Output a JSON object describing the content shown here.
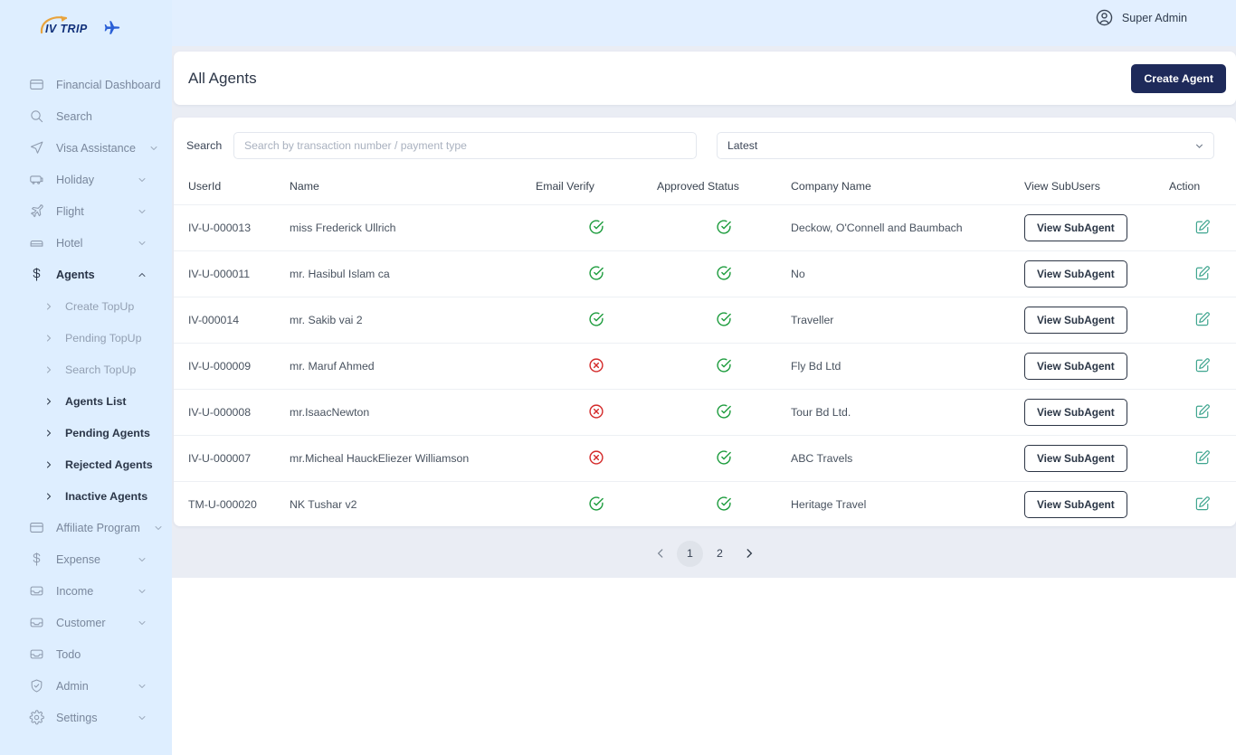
{
  "brand": {
    "logo_text": "IV TRIP",
    "arc_color": "#e8a33d",
    "plane_color": "#2a5fd6",
    "text_color": "#11307a"
  },
  "topbar": {
    "user_name": "Super Admin",
    "avatar_icon": "user-circle-icon"
  },
  "sidebar": {
    "items": [
      {
        "label": "Financial Dashboard",
        "icon": "card-icon",
        "chevron": false,
        "active": false
      },
      {
        "label": "Search",
        "icon": "search-icon",
        "chevron": false,
        "active": false
      },
      {
        "label": "Visa Assistance",
        "icon": "send-icon",
        "chevron": true,
        "active": false
      },
      {
        "label": "Holiday",
        "icon": "bus-icon",
        "chevron": true,
        "active": false
      },
      {
        "label": "Flight",
        "icon": "plane-icon",
        "chevron": true,
        "active": false
      },
      {
        "label": "Hotel",
        "icon": "bed-icon",
        "chevron": true,
        "active": false
      },
      {
        "label": "Agents",
        "icon": "dollar-icon",
        "chevron": true,
        "active": true
      }
    ],
    "sub_items": [
      {
        "label": "Create TopUp",
        "bold": false
      },
      {
        "label": "Pending TopUp",
        "bold": false
      },
      {
        "label": "Search TopUp",
        "bold": false
      },
      {
        "label": "Agents List",
        "bold": true
      },
      {
        "label": "Pending Agents",
        "bold": true
      },
      {
        "label": "Rejected Agents",
        "bold": true
      },
      {
        "label": "Inactive Agents",
        "bold": true
      }
    ],
    "items_after": [
      {
        "label": "Affiliate Program",
        "icon": "card-icon",
        "chevron": true,
        "active": false
      },
      {
        "label": "Expense",
        "icon": "dollar-icon",
        "chevron": true,
        "active": false
      },
      {
        "label": "Income",
        "icon": "inbox-icon",
        "chevron": true,
        "active": false
      },
      {
        "label": "Customer",
        "icon": "inbox-icon",
        "chevron": true,
        "active": false
      },
      {
        "label": "Todo",
        "icon": "inbox-icon",
        "chevron": false,
        "active": false
      },
      {
        "label": "Admin",
        "icon": "shield-icon",
        "chevron": true,
        "active": false
      },
      {
        "label": "Settings",
        "icon": "gear-icon",
        "chevron": true,
        "active": false
      }
    ]
  },
  "header": {
    "title": "All Agents",
    "create_button": "Create Agent"
  },
  "filters": {
    "search_label": "Search",
    "search_placeholder": "Search by transaction number / payment type",
    "search_value": "",
    "sort_selected": "Latest"
  },
  "table": {
    "columns": [
      "UserId",
      "Name",
      "Email Verify",
      "Approved Status",
      "Company Name",
      "View SubUsers",
      "Action"
    ],
    "view_sub_label": "View SubAgent",
    "rows": [
      {
        "userid": "IV-U-000013",
        "name": "miss Frederick Ullrich",
        "email_verify": "yes",
        "approved": "yes",
        "company": "Deckow, O'Connell and Baumbach"
      },
      {
        "userid": "IV-U-000011",
        "name": "mr. Hasibul Islam ca",
        "email_verify": "yes",
        "approved": "yes",
        "company": "No"
      },
      {
        "userid": "IV-000014",
        "name": "mr. Sakib vai 2",
        "email_verify": "yes",
        "approved": "yes",
        "company": "Traveller"
      },
      {
        "userid": "IV-U-000009",
        "name": "mr. Maruf Ahmed",
        "email_verify": "no",
        "approved": "yes",
        "company": "Fly Bd Ltd"
      },
      {
        "userid": "IV-U-000008",
        "name": "mr.IsaacNewton",
        "email_verify": "no",
        "approved": "yes",
        "company": "Tour Bd Ltd."
      },
      {
        "userid": "IV-U-000007",
        "name": "mr.Micheal HauckEliezer Williamson",
        "email_verify": "no",
        "approved": "yes",
        "company": "ABC Travels"
      },
      {
        "userid": "TM-U-000020",
        "name": "NK Tushar v2",
        "email_verify": "yes",
        "approved": "yes",
        "company": "Heritage Travel"
      }
    ]
  },
  "pagination": {
    "prev_icon": "chevron-left-icon",
    "next_icon": "chevron-right-icon",
    "pages": [
      "1",
      "2"
    ],
    "current": "1"
  },
  "colors": {
    "accent_dark": "#1e2a5a",
    "sidebar_bg": "#deeeff",
    "content_bg": "#eaedf4",
    "success": "#1f9d3f",
    "danger": "#d42b2b",
    "edit": "#3fa58f"
  }
}
